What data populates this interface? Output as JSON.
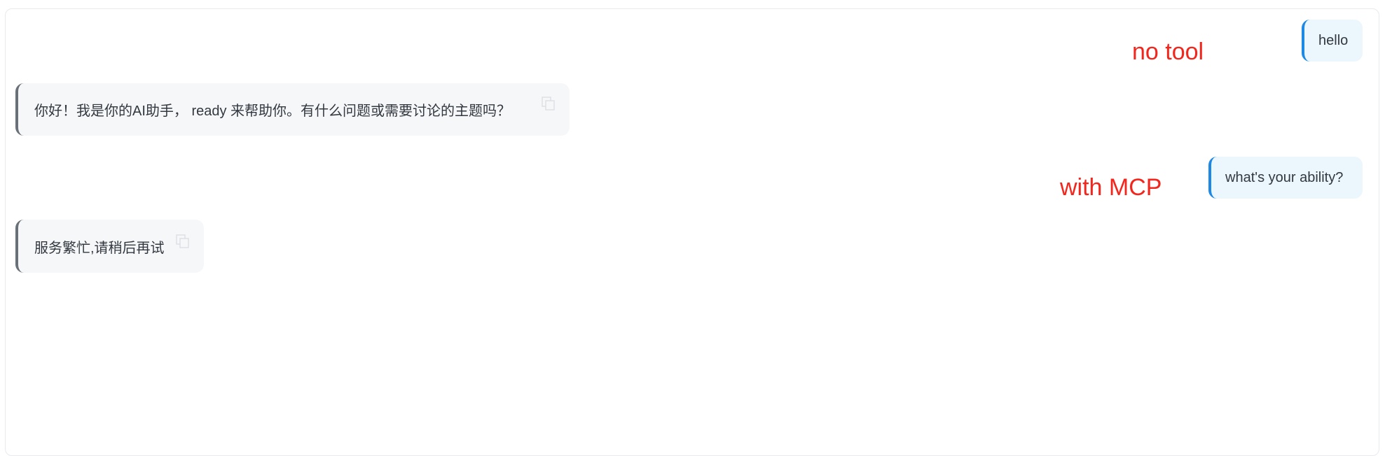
{
  "messages": [
    {
      "role": "user",
      "text": "hello"
    },
    {
      "role": "assistant",
      "text": "你好！我是你的AI助手， ready 来帮助你。有什么问题或需要讨论的主题吗？"
    },
    {
      "role": "user",
      "text": "what's your ability?"
    },
    {
      "role": "assistant",
      "text": "服务繁忙,请稍后再试"
    }
  ],
  "annotations": {
    "first": "no tool",
    "second": "with MCP"
  },
  "icons": {
    "copy": "copy-icon"
  },
  "colors": {
    "user_bubble_bg": "#ebf6fd",
    "user_bubble_border": "#1e88e5",
    "bot_bubble_bg": "#f6f7f9",
    "bot_bubble_border": "#6a7078",
    "annotation": "#f2261c"
  }
}
